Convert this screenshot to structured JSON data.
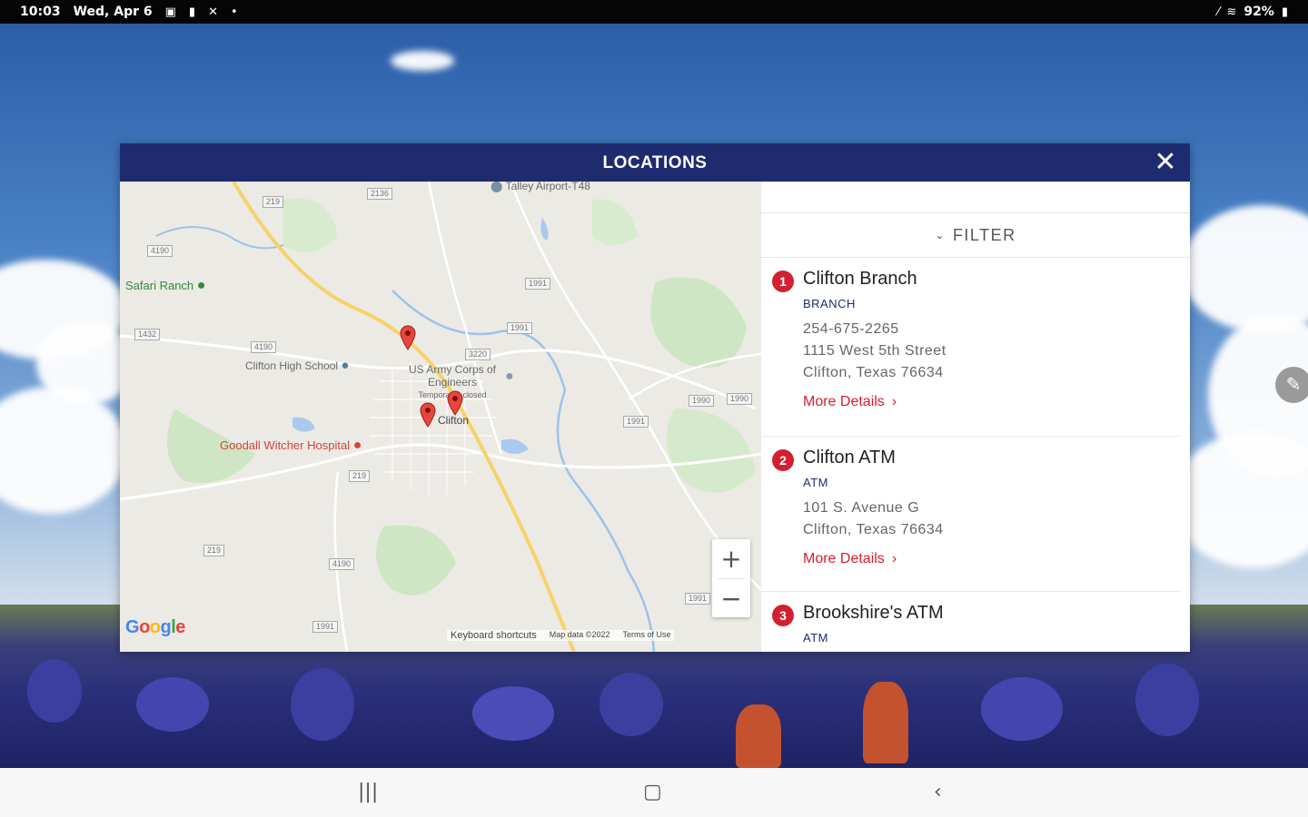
{
  "status_bar": {
    "time": "10:03",
    "date": "Wed, Apr 6",
    "battery": "92%",
    "icons_left": [
      "gallery-icon",
      "sim-icon",
      "missed-call-icon",
      "dot-icon"
    ],
    "icons_right": [
      "signal-icon",
      "wifi-icon",
      "battery-icon"
    ]
  },
  "modal": {
    "title": "LOCATIONS",
    "close_icon": "close-icon"
  },
  "map": {
    "labels": {
      "airport": "Talley Airport-T48",
      "safari": "Safari Ranch",
      "school": "Clifton High School",
      "army": "US Army Corps of Engineers",
      "army2": "Temporarily closed",
      "town": "Clifton",
      "hospital": "Goodall Witcher Hospital"
    },
    "zoom_in": "+",
    "zoom_out": "−",
    "google": "Google",
    "footer": [
      "Keyboard shortcuts",
      "Map data ©2022",
      "Terms of Use"
    ]
  },
  "filter": {
    "label": "FILTER",
    "icon": "chevron-down-icon"
  },
  "locations": [
    {
      "num": "1",
      "name": "Clifton Branch",
      "type": "BRANCH",
      "phone": "254-675-2265",
      "address1": "1115 West 5th Street",
      "address2": "Clifton, Texas 76634",
      "more": "More Details"
    },
    {
      "num": "2",
      "name": "Clifton ATM",
      "type": "ATM",
      "address1": "101 S. Avenue G",
      "address2": "Clifton, Texas 76634",
      "more": "More Details"
    },
    {
      "num": "3",
      "name": "Brookshire's ATM",
      "type": "ATM"
    }
  ],
  "nav": {
    "recents": "|||",
    "home": "▢",
    "back": "‹"
  }
}
